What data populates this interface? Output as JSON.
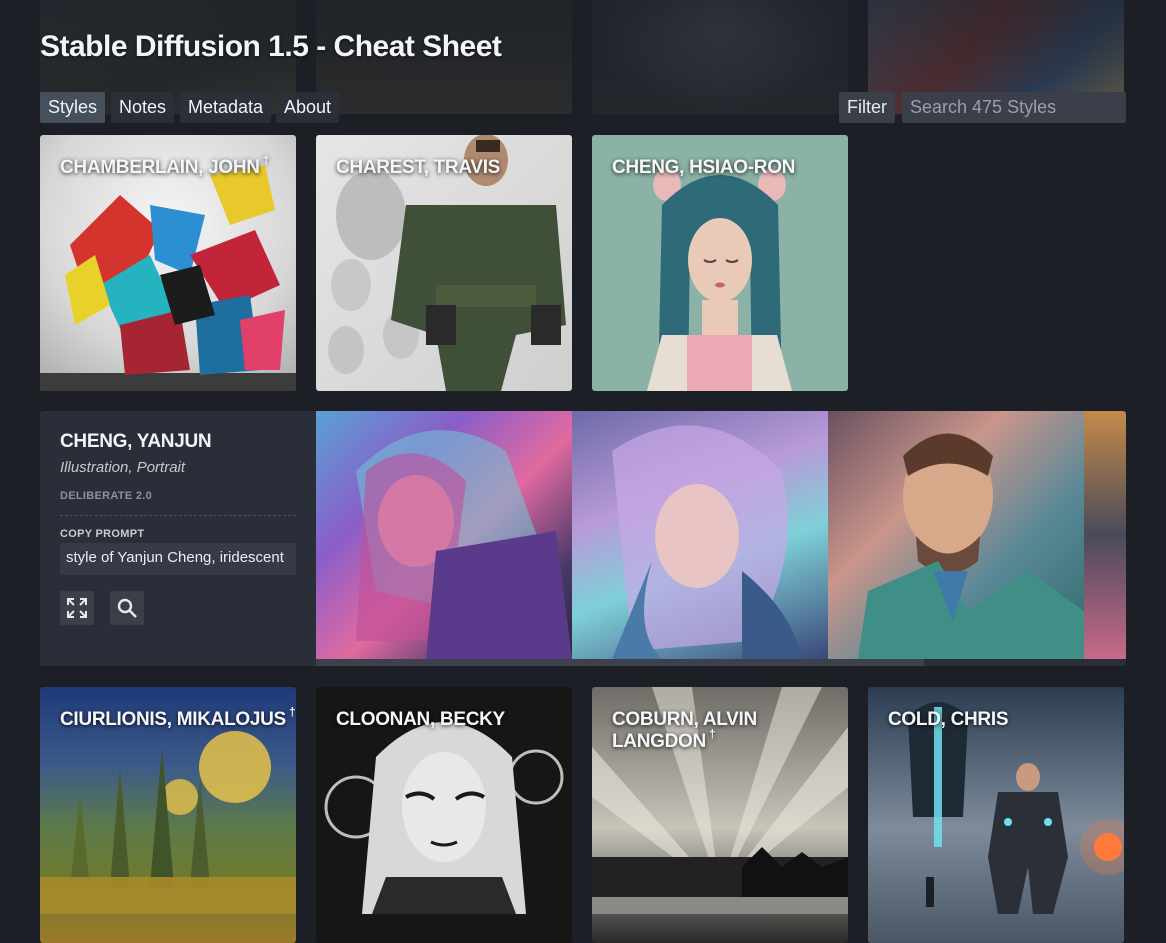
{
  "title": "Stable Diffusion 1.5 - Cheat Sheet",
  "tabs": [
    {
      "label": "Styles"
    },
    {
      "label": "Notes"
    },
    {
      "label": "Metadata"
    },
    {
      "label": "About"
    }
  ],
  "filter_label": "Filter",
  "search": {
    "placeholder": "Search 475 Styles",
    "value": ""
  },
  "cards_row1": [
    {
      "name": "CHAMBERLAIN, JOHN",
      "mark": "†"
    },
    {
      "name": "CHAREST, TRAVIS",
      "mark": ""
    },
    {
      "name": "CHENG, HSIAO-RON",
      "mark": ""
    }
  ],
  "detail": {
    "name": "CHENG, YANJUN",
    "tags": "Illustration, Portrait",
    "model": "DELIBERATE 2.0",
    "copy_label": "COPY PROMPT",
    "prompt": "style of Yanjun Cheng, iridescent",
    "icons": [
      "expand-icon",
      "search-icon"
    ]
  },
  "cards_row2": [
    {
      "name": "CIURLIONIS, MIKALOJUS",
      "mark": "†"
    },
    {
      "name": "CLOONAN, BECKY",
      "mark": ""
    },
    {
      "name": "COBURN, ALVIN LANGDON",
      "mark": "†"
    },
    {
      "name": "COLD, CHRIS",
      "mark": ""
    }
  ],
  "colors": {
    "background": "#1c1f26",
    "panel": "#2a2e38",
    "active_tab": "#46505c",
    "input": "#3a3f4a"
  }
}
